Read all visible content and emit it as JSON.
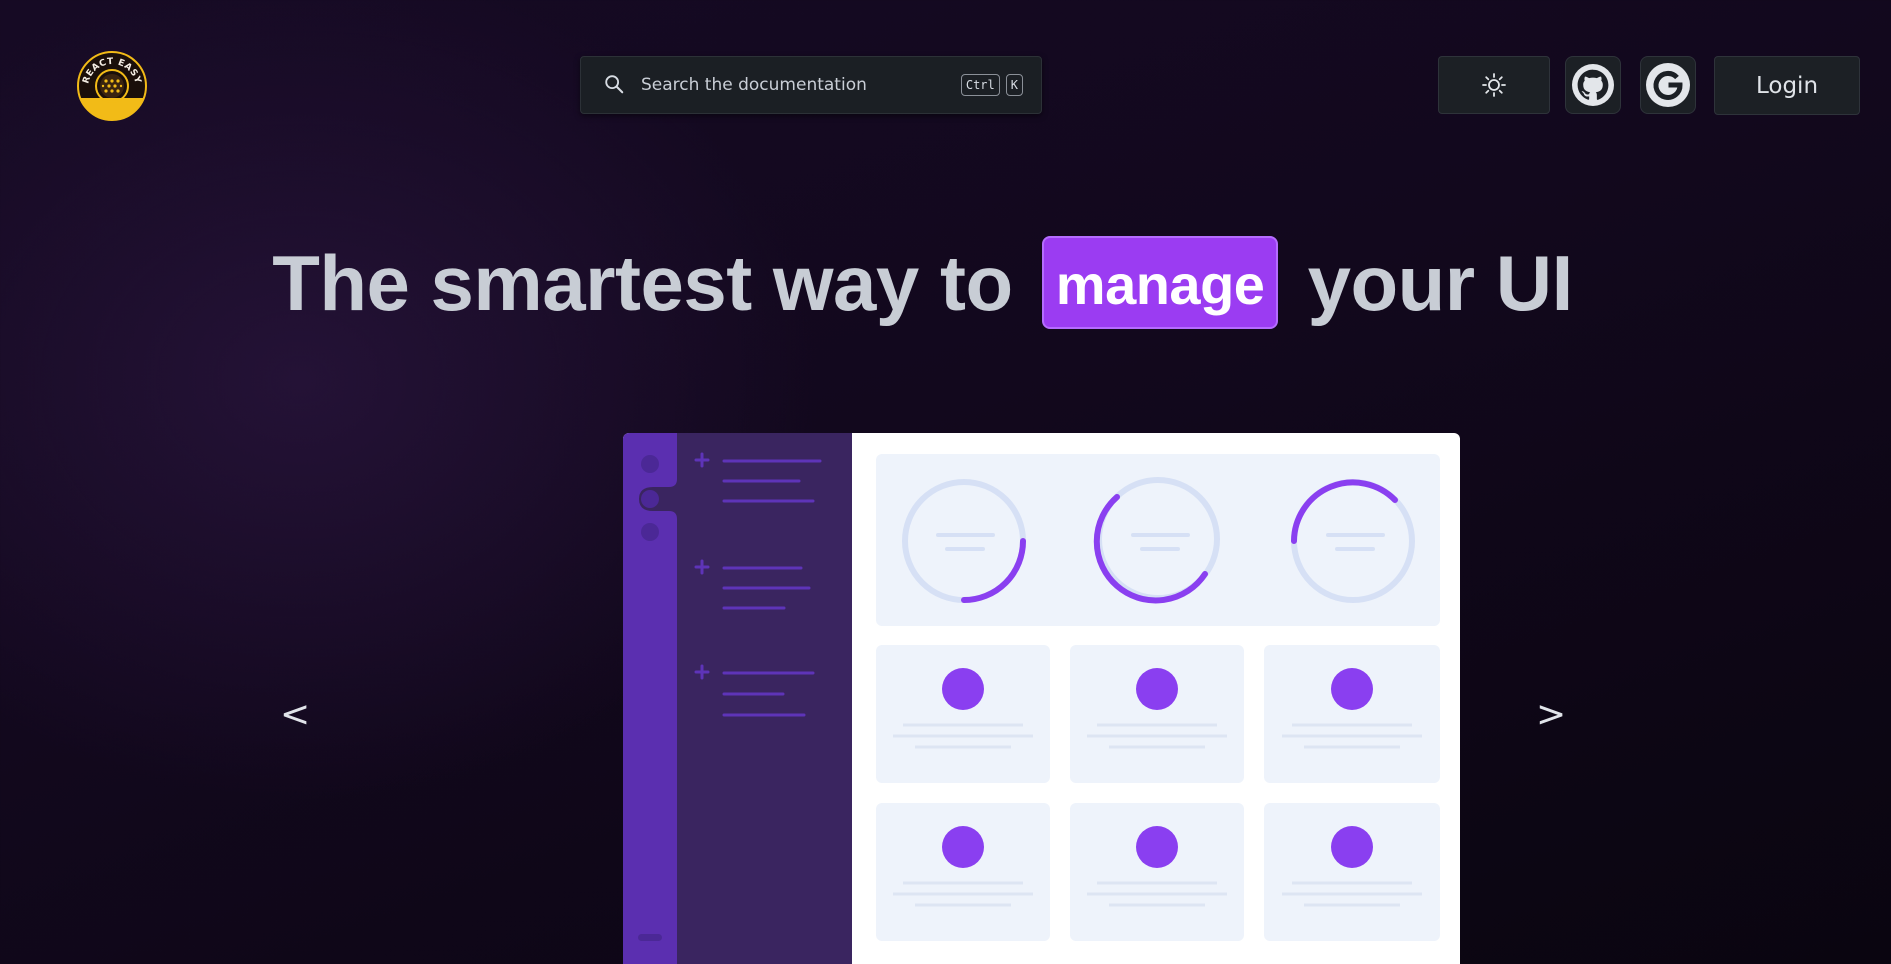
{
  "header": {
    "logo_text": "REACT EASY",
    "logo_icon": "react-easy-logo",
    "search": {
      "placeholder": "Search the documentation",
      "shortcut_keys": [
        "Ctrl",
        "K"
      ],
      "icon": "search-icon"
    },
    "theme_toggle_icon": "sun-icon",
    "github_icon": "github-icon",
    "google_icon": "google-icon",
    "login_label": "Login"
  },
  "hero": {
    "title_before": "The smartest way to",
    "title_highlight": "manage",
    "title_after": "your UI"
  },
  "carousel": {
    "prev_label": "<",
    "next_label": ">"
  },
  "colors": {
    "accent": "#9b3cf2",
    "sidebar_dark": "#5b2fb0",
    "sidebar_light": "#3a2560",
    "card_bg": "#eef3fb",
    "ring_track": "#d6e0f5",
    "ring_fill": "#8a3ff0",
    "logo_gold": "#f2bb17"
  }
}
